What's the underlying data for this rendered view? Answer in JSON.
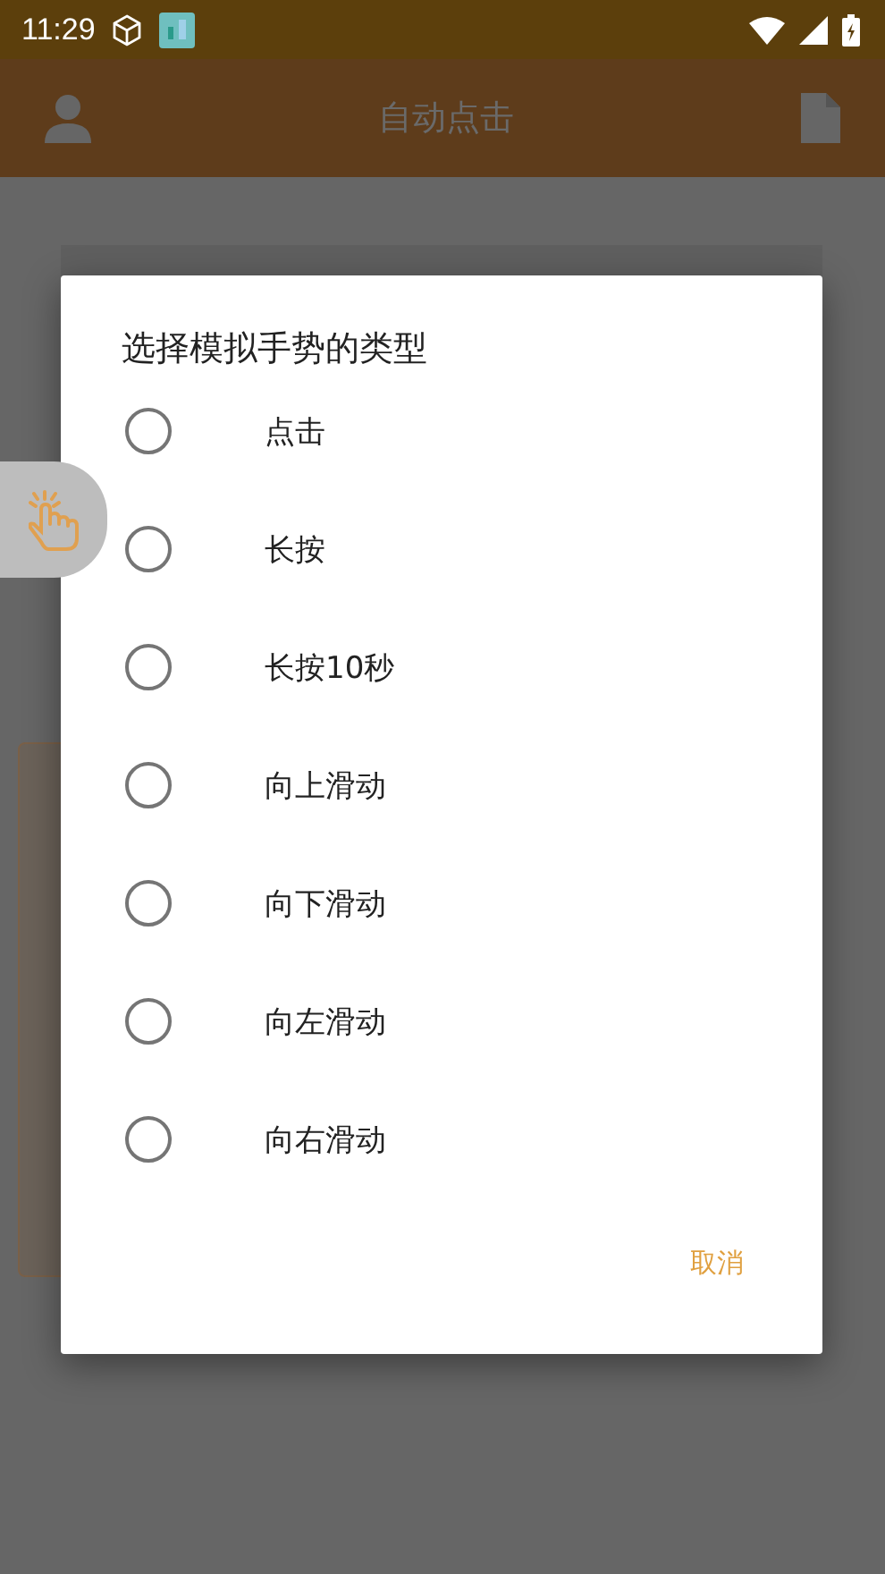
{
  "status_bar": {
    "time": "11:29"
  },
  "app_bar": {
    "title": "自动点击"
  },
  "dialog": {
    "title": "选择模拟手势的类型",
    "options": [
      {
        "label": "点击",
        "selected": false
      },
      {
        "label": "长按",
        "selected": false
      },
      {
        "label": "长按10秒",
        "selected": false
      },
      {
        "label": "向上滑动",
        "selected": false
      },
      {
        "label": "向下滑动",
        "selected": false
      },
      {
        "label": "向左滑动",
        "selected": false
      },
      {
        "label": "向右滑动",
        "selected": false
      }
    ],
    "buttons": [
      "取消"
    ]
  }
}
